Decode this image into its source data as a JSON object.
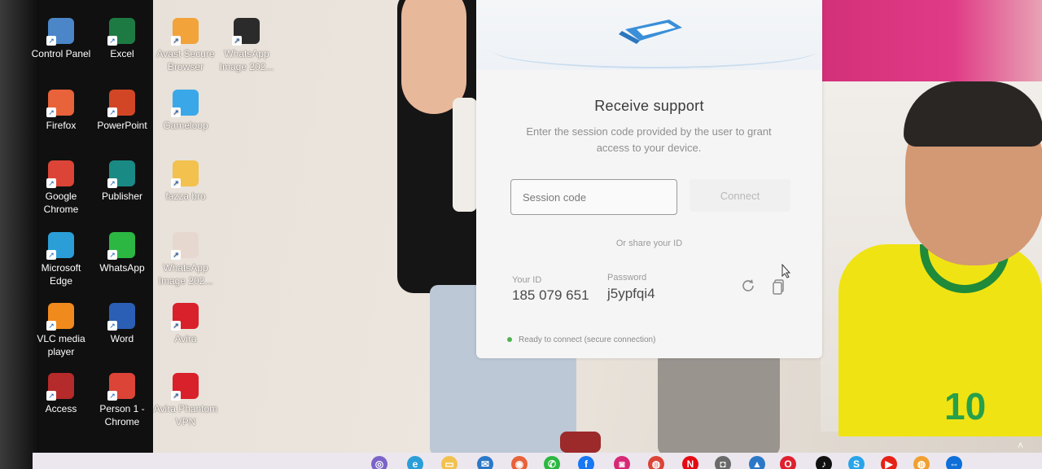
{
  "desktop": {
    "icons": [
      {
        "label": "Control Panel",
        "icon": "control-panel-icon",
        "color": "#4a86c8"
      },
      {
        "label": "Excel",
        "icon": "excel-icon",
        "color": "#1e7a43"
      },
      {
        "label": "Avast Secure Browser",
        "icon": "avast-browser-icon",
        "color": "#f2a33a"
      },
      {
        "label": "WhatsApp Image 202...",
        "icon": "image-file-icon",
        "color": "#2b2b2b"
      },
      {
        "label": "Firefox",
        "icon": "firefox-icon",
        "color": "#e8623a"
      },
      {
        "label": "PowerPoint",
        "icon": "powerpoint-icon",
        "color": "#d24625"
      },
      {
        "label": "Gameloop",
        "icon": "gameloop-icon",
        "color": "#3aa8e8"
      },
      {
        "label": "Google Chrome",
        "icon": "chrome-icon",
        "color": "#db4437"
      },
      {
        "label": "Publisher",
        "icon": "publisher-icon",
        "color": "#1a8a84"
      },
      {
        "label": "fazza bro",
        "icon": "folder-icon",
        "color": "#f2c14e"
      },
      {
        "label": "Microsoft Edge",
        "icon": "edge-icon",
        "color": "#2b9ed8"
      },
      {
        "label": "WhatsApp",
        "icon": "whatsapp-icon",
        "color": "#2cb742"
      },
      {
        "label": "WhatsApp Image 202...",
        "icon": "image-file-icon",
        "color": "#e6d8cf"
      },
      {
        "label": "VLC media player",
        "icon": "vlc-icon",
        "color": "#f08a1c"
      },
      {
        "label": "Word",
        "icon": "word-icon",
        "color": "#2b5fb5"
      },
      {
        "label": "Avira",
        "icon": "avira-icon",
        "color": "#d9212b"
      },
      {
        "label": "Access",
        "icon": "access-icon",
        "color": "#b52a2a"
      },
      {
        "label": "Person 1 - Chrome",
        "icon": "chrome-profile-icon",
        "color": "#db4437"
      },
      {
        "label": "Avira Phantom VPN",
        "icon": "avira-vpn-icon",
        "color": "#d9212b"
      }
    ]
  },
  "dialog": {
    "title": "Receive support",
    "description": "Enter the session code provided by the user to grant access to your device.",
    "session_placeholder": "Session code",
    "connect_label": "Connect",
    "share_label": "Or share your ID",
    "your_id_label": "Your ID",
    "your_id_value": "185 079 651",
    "password_label": "Password",
    "password_value": "j5ypfqi4",
    "status_text": "Ready to connect (secure connection)",
    "status_color": "#4fb34f"
  },
  "wallpaper": {
    "shirt_number": "10"
  },
  "taskbar": {
    "icons": [
      {
        "name": "phone-link-icon",
        "glyph": "◎",
        "color": "#7b63c8"
      },
      {
        "name": "edge-taskbar-icon",
        "glyph": "e",
        "color": "#2b9ed8"
      },
      {
        "name": "file-explorer-icon",
        "glyph": "▭",
        "color": "#f2c14e"
      },
      {
        "name": "mail-icon",
        "glyph": "✉",
        "color": "#2b78c8"
      },
      {
        "name": "firefox-taskbar-icon",
        "glyph": "◉",
        "color": "#e8623a"
      },
      {
        "name": "whatsapp-taskbar-icon",
        "glyph": "✆",
        "color": "#2cb742"
      },
      {
        "name": "facebook-icon",
        "glyph": "f",
        "color": "#1877f2"
      },
      {
        "name": "instagram-icon",
        "glyph": "◙",
        "color": "#d62976"
      },
      {
        "name": "chrome-taskbar-icon",
        "glyph": "◍",
        "color": "#db4437"
      },
      {
        "name": "netflix-icon",
        "glyph": "N",
        "color": "#e50914"
      },
      {
        "name": "camera-icon",
        "glyph": "◘",
        "color": "#6a6a6a"
      },
      {
        "name": "photos-icon",
        "glyph": "▲",
        "color": "#2b78c8"
      },
      {
        "name": "opera-icon",
        "glyph": "O",
        "color": "#e0202e"
      },
      {
        "name": "tiktok-icon",
        "glyph": "♪",
        "color": "#111111"
      },
      {
        "name": "skype-icon",
        "glyph": "S",
        "color": "#2aa4e8"
      },
      {
        "name": "youtube-icon",
        "glyph": "▶",
        "color": "#e62117"
      },
      {
        "name": "chrome-profile-taskbar-icon",
        "glyph": "◍",
        "color": "#f0a030"
      },
      {
        "name": "teamviewer-icon",
        "glyph": "⇔",
        "color": "#0e6fd8"
      }
    ]
  }
}
